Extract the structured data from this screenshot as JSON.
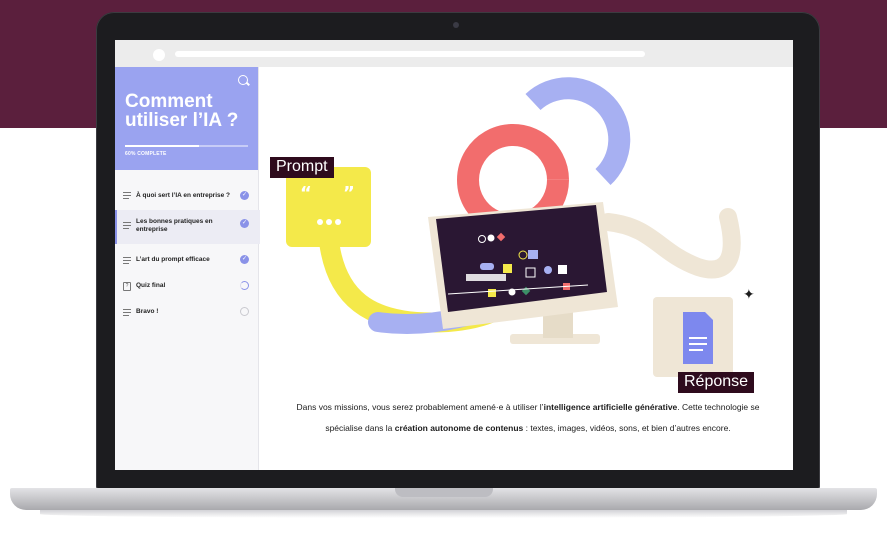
{
  "course": {
    "title": "Comment utiliser l’IA ?",
    "progress_label": "60% COMPLETE",
    "progress_value": 0.6
  },
  "lessons": [
    {
      "label": "À quoi sert l’IA en entreprise ?",
      "status": "done",
      "icon": "list-icon"
    },
    {
      "label": "Les bonnes pratiques en entreprise",
      "status": "done",
      "icon": "list-icon"
    },
    {
      "label": "L’art du prompt efficace",
      "status": "done",
      "icon": "list-icon"
    },
    {
      "label": "Quiz final",
      "status": "in-progress",
      "icon": "quiz-icon"
    },
    {
      "label": "Bravo !",
      "status": "not-started",
      "icon": "list-icon"
    }
  ],
  "illustration": {
    "prompt_label": "Prompt",
    "response_label": "Réponse"
  },
  "paragraph": {
    "p1": "Dans vos missions, vous serez probablement amené·e à utiliser l’",
    "b1": "intelligence artificielle générative",
    "p2": ". Cette technologie se spécialise dans la ",
    "b2": "création autonome de contenus",
    "p3": " : textes, images, vidéos, sons, et bien d’autres encore."
  },
  "colors": {
    "brand_dark": "#5b1f3d",
    "accent": "#9aa3f0",
    "yellow": "#f4e94a",
    "coral": "#f26d6d",
    "cream": "#efe6d6"
  }
}
